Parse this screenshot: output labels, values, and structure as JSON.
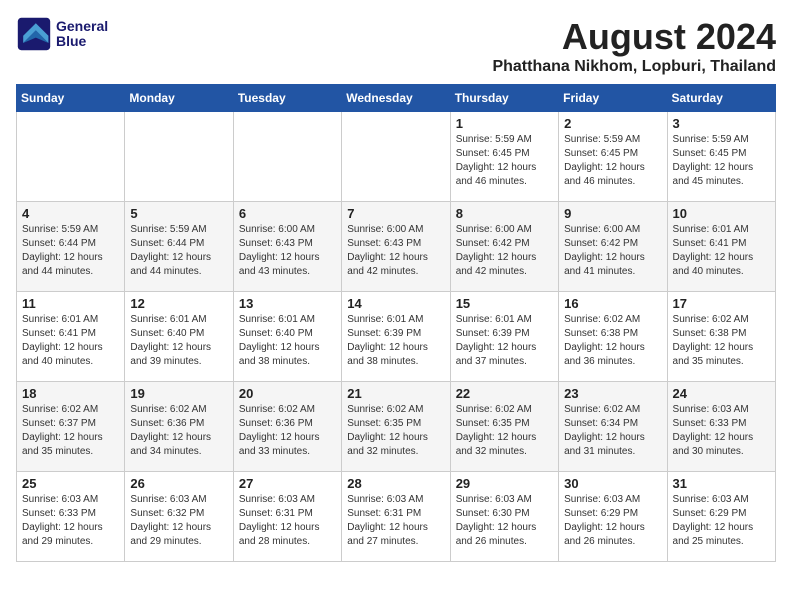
{
  "logo": {
    "line1": "General",
    "line2": "Blue"
  },
  "title": "August 2024",
  "subtitle": "Phatthana Nikhom, Lopburi, Thailand",
  "days_of_week": [
    "Sunday",
    "Monday",
    "Tuesday",
    "Wednesday",
    "Thursday",
    "Friday",
    "Saturday"
  ],
  "weeks": [
    [
      {
        "day": "",
        "detail": ""
      },
      {
        "day": "",
        "detail": ""
      },
      {
        "day": "",
        "detail": ""
      },
      {
        "day": "",
        "detail": ""
      },
      {
        "day": "1",
        "detail": "Sunrise: 5:59 AM\nSunset: 6:45 PM\nDaylight: 12 hours\nand 46 minutes."
      },
      {
        "day": "2",
        "detail": "Sunrise: 5:59 AM\nSunset: 6:45 PM\nDaylight: 12 hours\nand 46 minutes."
      },
      {
        "day": "3",
        "detail": "Sunrise: 5:59 AM\nSunset: 6:45 PM\nDaylight: 12 hours\nand 45 minutes."
      }
    ],
    [
      {
        "day": "4",
        "detail": "Sunrise: 5:59 AM\nSunset: 6:44 PM\nDaylight: 12 hours\nand 44 minutes."
      },
      {
        "day": "5",
        "detail": "Sunrise: 5:59 AM\nSunset: 6:44 PM\nDaylight: 12 hours\nand 44 minutes."
      },
      {
        "day": "6",
        "detail": "Sunrise: 6:00 AM\nSunset: 6:43 PM\nDaylight: 12 hours\nand 43 minutes."
      },
      {
        "day": "7",
        "detail": "Sunrise: 6:00 AM\nSunset: 6:43 PM\nDaylight: 12 hours\nand 42 minutes."
      },
      {
        "day": "8",
        "detail": "Sunrise: 6:00 AM\nSunset: 6:42 PM\nDaylight: 12 hours\nand 42 minutes."
      },
      {
        "day": "9",
        "detail": "Sunrise: 6:00 AM\nSunset: 6:42 PM\nDaylight: 12 hours\nand 41 minutes."
      },
      {
        "day": "10",
        "detail": "Sunrise: 6:01 AM\nSunset: 6:41 PM\nDaylight: 12 hours\nand 40 minutes."
      }
    ],
    [
      {
        "day": "11",
        "detail": "Sunrise: 6:01 AM\nSunset: 6:41 PM\nDaylight: 12 hours\nand 40 minutes."
      },
      {
        "day": "12",
        "detail": "Sunrise: 6:01 AM\nSunset: 6:40 PM\nDaylight: 12 hours\nand 39 minutes."
      },
      {
        "day": "13",
        "detail": "Sunrise: 6:01 AM\nSunset: 6:40 PM\nDaylight: 12 hours\nand 38 minutes."
      },
      {
        "day": "14",
        "detail": "Sunrise: 6:01 AM\nSunset: 6:39 PM\nDaylight: 12 hours\nand 38 minutes."
      },
      {
        "day": "15",
        "detail": "Sunrise: 6:01 AM\nSunset: 6:39 PM\nDaylight: 12 hours\nand 37 minutes."
      },
      {
        "day": "16",
        "detail": "Sunrise: 6:02 AM\nSunset: 6:38 PM\nDaylight: 12 hours\nand 36 minutes."
      },
      {
        "day": "17",
        "detail": "Sunrise: 6:02 AM\nSunset: 6:38 PM\nDaylight: 12 hours\nand 35 minutes."
      }
    ],
    [
      {
        "day": "18",
        "detail": "Sunrise: 6:02 AM\nSunset: 6:37 PM\nDaylight: 12 hours\nand 35 minutes."
      },
      {
        "day": "19",
        "detail": "Sunrise: 6:02 AM\nSunset: 6:36 PM\nDaylight: 12 hours\nand 34 minutes."
      },
      {
        "day": "20",
        "detail": "Sunrise: 6:02 AM\nSunset: 6:36 PM\nDaylight: 12 hours\nand 33 minutes."
      },
      {
        "day": "21",
        "detail": "Sunrise: 6:02 AM\nSunset: 6:35 PM\nDaylight: 12 hours\nand 32 minutes."
      },
      {
        "day": "22",
        "detail": "Sunrise: 6:02 AM\nSunset: 6:35 PM\nDaylight: 12 hours\nand 32 minutes."
      },
      {
        "day": "23",
        "detail": "Sunrise: 6:02 AM\nSunset: 6:34 PM\nDaylight: 12 hours\nand 31 minutes."
      },
      {
        "day": "24",
        "detail": "Sunrise: 6:03 AM\nSunset: 6:33 PM\nDaylight: 12 hours\nand 30 minutes."
      }
    ],
    [
      {
        "day": "25",
        "detail": "Sunrise: 6:03 AM\nSunset: 6:33 PM\nDaylight: 12 hours\nand 29 minutes."
      },
      {
        "day": "26",
        "detail": "Sunrise: 6:03 AM\nSunset: 6:32 PM\nDaylight: 12 hours\nand 29 minutes."
      },
      {
        "day": "27",
        "detail": "Sunrise: 6:03 AM\nSunset: 6:31 PM\nDaylight: 12 hours\nand 28 minutes."
      },
      {
        "day": "28",
        "detail": "Sunrise: 6:03 AM\nSunset: 6:31 PM\nDaylight: 12 hours\nand 27 minutes."
      },
      {
        "day": "29",
        "detail": "Sunrise: 6:03 AM\nSunset: 6:30 PM\nDaylight: 12 hours\nand 26 minutes."
      },
      {
        "day": "30",
        "detail": "Sunrise: 6:03 AM\nSunset: 6:29 PM\nDaylight: 12 hours\nand 26 minutes."
      },
      {
        "day": "31",
        "detail": "Sunrise: 6:03 AM\nSunset: 6:29 PM\nDaylight: 12 hours\nand 25 minutes."
      }
    ]
  ]
}
